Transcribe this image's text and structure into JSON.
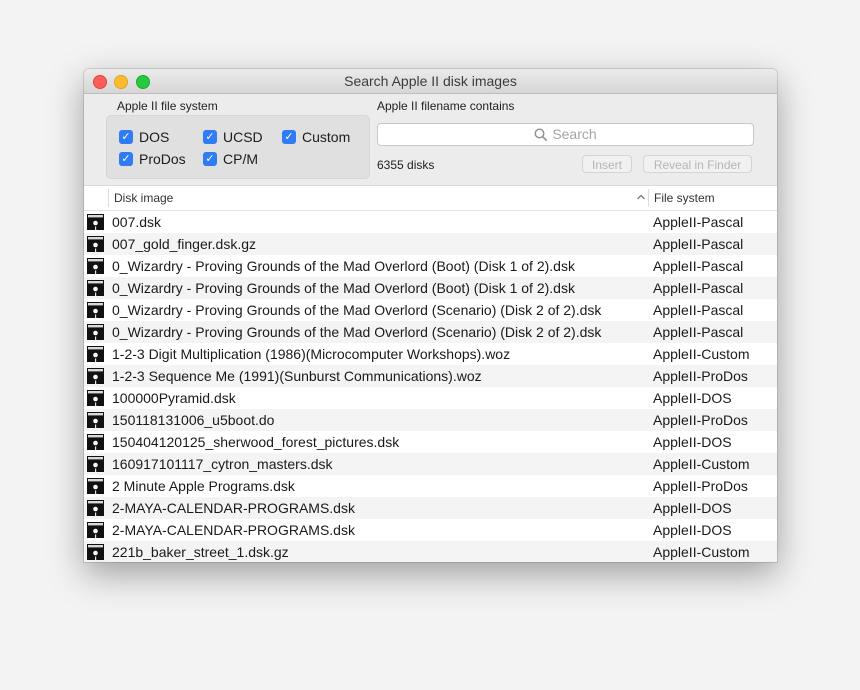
{
  "window": {
    "title": "Search Apple II disk images"
  },
  "filesystem": {
    "label": "Apple II file system",
    "options": [
      {
        "label": "DOS",
        "checked": true
      },
      {
        "label": "UCSD",
        "checked": true
      },
      {
        "label": "Custom",
        "checked": true
      },
      {
        "label": "ProDos",
        "checked": true
      },
      {
        "label": "CP/M",
        "checked": true
      }
    ]
  },
  "filename": {
    "label": "Apple II filename contains",
    "placeholder": "Search",
    "value": ""
  },
  "count": "6355 disks",
  "buttons": {
    "insert": "Insert",
    "reveal": "Reveal in Finder"
  },
  "table": {
    "columns": [
      "Disk image",
      "File system"
    ],
    "rows": [
      {
        "name": "007.dsk",
        "fs": "AppleII-Pascal"
      },
      {
        "name": "007_gold_finger.dsk.gz",
        "fs": "AppleII-Pascal"
      },
      {
        "name": "0_Wizardry - Proving Grounds of the Mad Overlord (Boot) (Disk 1 of 2).dsk",
        "fs": "AppleII-Pascal"
      },
      {
        "name": "0_Wizardry - Proving Grounds of the Mad Overlord (Boot) (Disk 1 of 2).dsk",
        "fs": "AppleII-Pascal"
      },
      {
        "name": "0_Wizardry - Proving Grounds of the Mad Overlord (Scenario) (Disk 2 of 2).dsk",
        "fs": "AppleII-Pascal"
      },
      {
        "name": "0_Wizardry - Proving Grounds of the Mad Overlord (Scenario) (Disk 2 of 2).dsk",
        "fs": "AppleII-Pascal"
      },
      {
        "name": "1-2-3 Digit Multiplication (1986)(Microcomputer Workshops).woz",
        "fs": "AppleII-Custom"
      },
      {
        "name": "1-2-3 Sequence Me (1991)(Sunburst Communications).woz",
        "fs": "AppleII-ProDos"
      },
      {
        "name": "100000Pyramid.dsk",
        "fs": "AppleII-DOS"
      },
      {
        "name": "150118131006_u5boot.do",
        "fs": "AppleII-ProDos"
      },
      {
        "name": "150404120125_sherwood_forest_pictures.dsk",
        "fs": "AppleII-DOS"
      },
      {
        "name": "160917101117_cytron_masters.dsk",
        "fs": "AppleII-Custom"
      },
      {
        "name": "2 Minute Apple Programs.dsk",
        "fs": "AppleII-ProDos"
      },
      {
        "name": "2-MAYA-CALENDAR-PROGRAMS.dsk",
        "fs": "AppleII-DOS"
      },
      {
        "name": "2-MAYA-CALENDAR-PROGRAMS.dsk",
        "fs": "AppleII-DOS"
      },
      {
        "name": "221b_baker_street_1.dsk.gz",
        "fs": "AppleII-Custom"
      }
    ]
  },
  "colors": {
    "accent": "#2f7cf6",
    "close": "#fc5f57",
    "minimize": "#fdbc2e",
    "zoom": "#28c840"
  },
  "icons": {
    "row": "floppy-disk-icon",
    "search": "magnifier-icon",
    "sort": "chevron-up-icon"
  }
}
